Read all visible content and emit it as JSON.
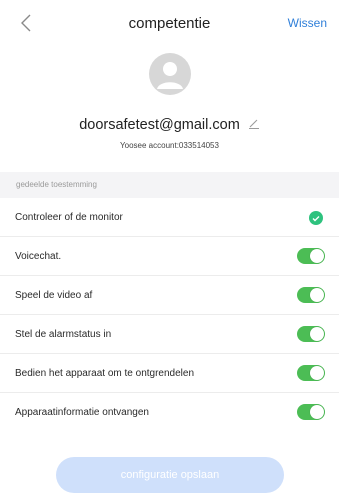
{
  "header": {
    "title": "competentie",
    "clear_label": "Wissen",
    "back_icon": "chevron-left-icon"
  },
  "profile": {
    "email": "doorsafetest@gmail.com",
    "account": "Yoosee account:033514053",
    "avatar_icon": "user-avatar-icon",
    "edit_icon": "pencil-icon"
  },
  "section": {
    "label": "gedeelde toestemming"
  },
  "permissions": [
    {
      "label": "Controleer of de monitor",
      "control": "check",
      "enabled": true
    },
    {
      "label": "Voicechat.",
      "control": "toggle",
      "enabled": true
    },
    {
      "label": "Speel de video af",
      "control": "toggle",
      "enabled": true
    },
    {
      "label": "Stel de alarmstatus in",
      "control": "toggle",
      "enabled": true
    },
    {
      "label": "Bedien het apparaat om te ontgrendelen",
      "control": "toggle",
      "enabled": true
    },
    {
      "label": "Apparaatinformatie ontvangen",
      "control": "toggle",
      "enabled": true
    }
  ],
  "footer": {
    "save_label": "configuratie opslaan"
  },
  "colors": {
    "accent": "#2f7fd9",
    "toggle_on": "#4cbd55",
    "check": "#2ec27e",
    "save_button": "#cfe0fb"
  }
}
